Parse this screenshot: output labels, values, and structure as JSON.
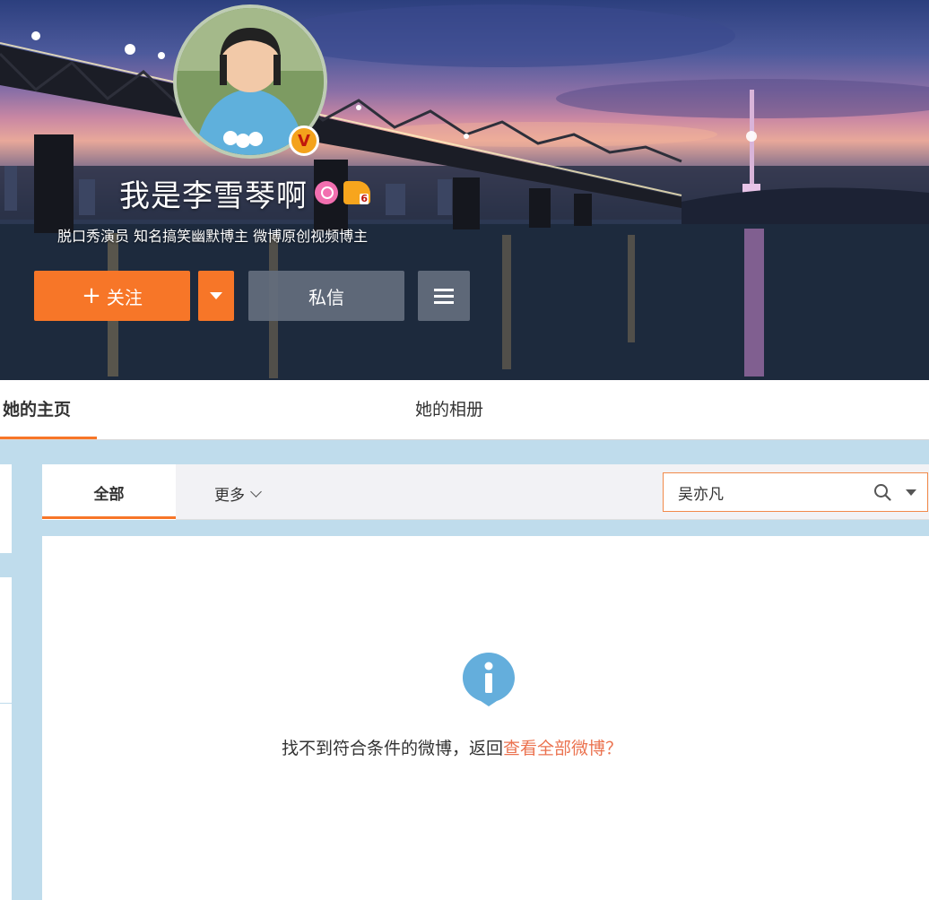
{
  "profile": {
    "name": "我是李雪琴啊",
    "bio": "脱口秀演员 知名搞笑幽默博主 微博原创视频博主",
    "verified_badge": "V",
    "follow_label": "关注",
    "message_label": "私信"
  },
  "tabs": {
    "home": "她的主页",
    "album": "她的相册"
  },
  "feed": {
    "all_tab": "全部",
    "more_tab": "更多",
    "search_value": "吴亦凡",
    "empty_message": "找不到符合条件的微博，返回",
    "empty_link": "查看全部微博？"
  },
  "colors": {
    "accent": "#f77628",
    "link": "#eb7350",
    "info": "#64aedc"
  },
  "icons": [
    "female-icon",
    "member-icon",
    "verified-icon",
    "menu-icon",
    "search-icon",
    "chevron-down-icon",
    "info-icon"
  ]
}
